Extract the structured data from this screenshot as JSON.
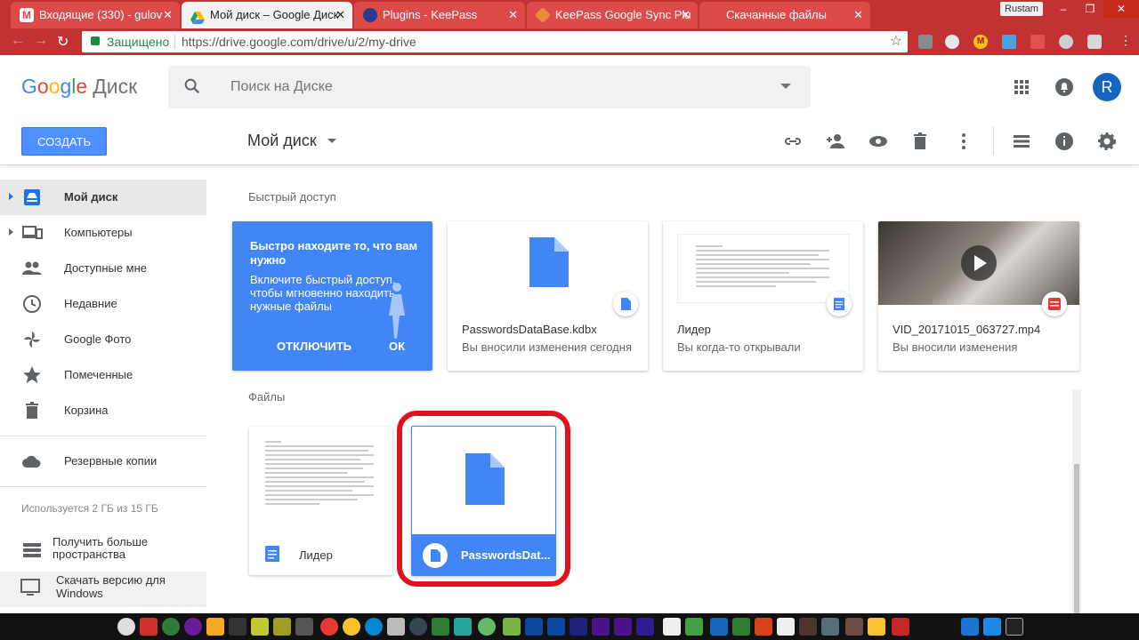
{
  "browser": {
    "tabs": [
      {
        "title": "Входящие (330) - gulov",
        "active": false
      },
      {
        "title": "Мой диск – Google Диск",
        "active": true
      },
      {
        "title": "Plugins - KeePass",
        "active": false
      },
      {
        "title": "KeePass Google Sync Plu",
        "active": false
      },
      {
        "title": "Скачанные файлы",
        "active": false
      }
    ],
    "user": "Rustam",
    "secure_label": "Защищено",
    "url": "https://drive.google.com/drive/u/2/my-drive"
  },
  "header": {
    "logo_google": [
      "G",
      "o",
      "o",
      "g",
      "l",
      "e"
    ],
    "logo_product": "Диск",
    "search_placeholder": "Поиск на Диске",
    "avatar_letter": "R",
    "create_label": "СОЗДАТЬ",
    "page_title": "Мой диск"
  },
  "sidebar": {
    "items": [
      {
        "label": "Мой диск",
        "icon": "drive-icon",
        "active": true
      },
      {
        "label": "Компьютеры",
        "icon": "computer-icon",
        "active": false
      },
      {
        "label": "Доступные мне",
        "icon": "people-icon",
        "active": false
      },
      {
        "label": "Недавние",
        "icon": "clock-icon",
        "active": false
      },
      {
        "label": "Google Фото",
        "icon": "pinwheel-icon",
        "active": false
      },
      {
        "label": "Помеченные",
        "icon": "star-icon",
        "active": false
      },
      {
        "label": "Корзина",
        "icon": "trash-icon",
        "active": false
      }
    ],
    "backups_label": "Резервные копии",
    "storage_text": "Используется 2 ГБ из 15 ГБ",
    "more_storage_line1": "Получить больше",
    "more_storage_line2": "пространства",
    "download_line1": "Скачать версию для",
    "download_line2": "Windows"
  },
  "quick_access": {
    "title": "Быстрый доступ",
    "promo_title": "Быстро находите то, что вам нужно",
    "promo_body": "Включите быстрый доступ, чтобы мгновенно находить нужные файлы",
    "promo_disable": "ОТКЛЮЧИТЬ",
    "promo_ok": "ОК",
    "cards": [
      {
        "name": "PasswordsDataBase.kdbx",
        "meta": "Вы вносили изменения сегодня",
        "icon": "file-icon"
      },
      {
        "name": "Лидер",
        "meta": "Вы когда-то открывали",
        "icon": "docs-icon"
      },
      {
        "name": "VID_20171015_063727.mp4",
        "meta": "Вы вносили изменения",
        "icon": "video-icon"
      }
    ]
  },
  "files": {
    "title": "Файлы",
    "items": [
      {
        "name": "Лидер",
        "selected": false
      },
      {
        "name": "PasswordsDat...",
        "selected": true
      }
    ]
  },
  "colors": {
    "accent": "#4285f4",
    "chrome": "#c23232",
    "highlight": "#e0121e"
  }
}
